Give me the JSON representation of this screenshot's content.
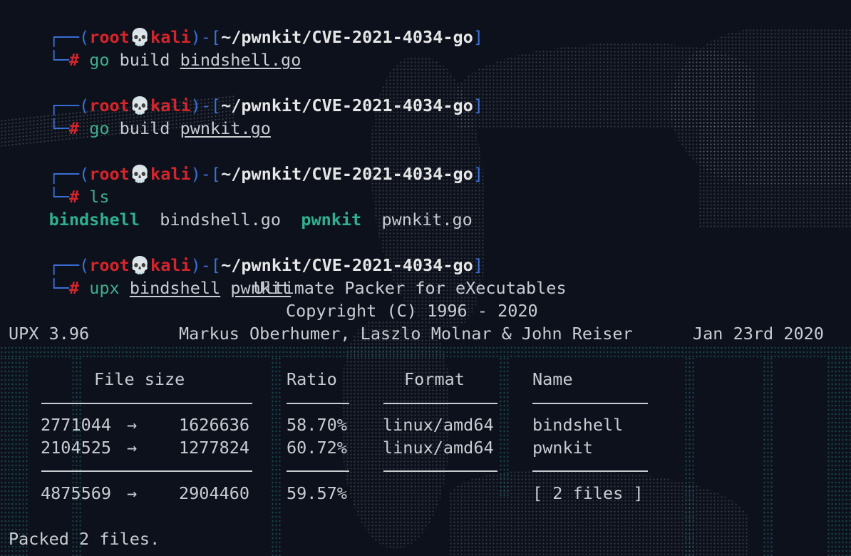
{
  "prompts": [
    {
      "open": "┌──(",
      "user": "root",
      "skull": "💀",
      "host": "kali",
      "mid": ")-[",
      "path": "~/pwnkit/CVE-2021-4034-go",
      "close": "]",
      "corner": "└─",
      "hash": "#",
      "cmd": "go",
      "args": [
        "build",
        "bindshell.go"
      ]
    },
    {
      "open": "┌──(",
      "user": "root",
      "skull": "💀",
      "host": "kali",
      "mid": ")-[",
      "path": "~/pwnkit/CVE-2021-4034-go",
      "close": "]",
      "corner": "└─",
      "hash": "#",
      "cmd": "go",
      "args": [
        "build",
        "pwnkit.go"
      ]
    },
    {
      "open": "┌──(",
      "user": "root",
      "skull": "💀",
      "host": "kali",
      "mid": ")-[",
      "path": "~/pwnkit/CVE-2021-4034-go",
      "close": "]",
      "corner": "└─",
      "hash": "#",
      "cmd": "ls",
      "args": []
    },
    {
      "open": "┌──(",
      "user": "root",
      "skull": "💀",
      "host": "kali",
      "mid": ")-[",
      "path": "~/pwnkit/CVE-2021-4034-go",
      "close": "]",
      "corner": "└─",
      "hash": "#",
      "cmd": "upx",
      "args": [
        "bindshell",
        "pwnkit"
      ]
    }
  ],
  "ls_output": [
    "bindshell",
    "bindshell.go",
    "pwnkit",
    "pwnkit.go"
  ],
  "upx": {
    "title": "Ultimate Packer for eXecutables",
    "copyright": "Copyright (C) 1996 - 2020",
    "version": "UPX 3.96",
    "authors": "Markus Oberhumer, Laszlo Molnar & John Reiser",
    "date": "Jan 23rd 2020",
    "headers": {
      "filesize": "File size",
      "ratio": "Ratio",
      "format": "Format",
      "name": "Name"
    },
    "rows": [
      {
        "orig": "2771044",
        "arrow": "->",
        "packed": "1626636",
        "ratio": "58.70%",
        "format": "linux/amd64",
        "name": "bindshell"
      },
      {
        "orig": "2104525",
        "arrow": "->",
        "packed": "1277824",
        "ratio": "60.72%",
        "format": "linux/amd64",
        "name": "pwnkit"
      }
    ],
    "total": {
      "orig": "4875569",
      "arrow": "->",
      "packed": "2904460",
      "ratio": "59.57%",
      "name": "[ 2 files ]"
    },
    "result": "Packed 2 files."
  },
  "colors": {
    "background": "#0c111c",
    "frame": "#3b6fd6",
    "root": "#d6242b",
    "command": "#3fae8b",
    "text": "#c9ccd1"
  }
}
